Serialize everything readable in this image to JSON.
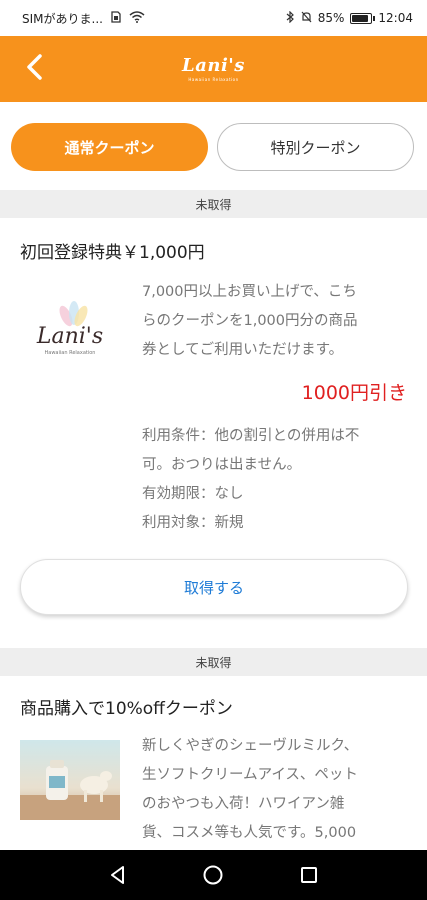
{
  "status_bar": {
    "carrier": "SIMがありま...",
    "battery_percent": "85%",
    "time": "12:04",
    "battery_level": 0.85
  },
  "header": {
    "logo_text": "Lani's",
    "logo_subtext": "Hawaiian Relaxation",
    "accent_color": "#f7921c"
  },
  "tabs": [
    {
      "label": "通常クーポン",
      "active": true
    },
    {
      "label": "特別クーポン",
      "active": false
    }
  ],
  "coupons": [
    {
      "status": "未取得",
      "title": "初回登録特典￥1,000円",
      "logo_text": "Lani's",
      "logo_subtext": "Hawaiian Relaxation",
      "description": [
        "7,000円以上お買い上げで、こち",
        "らのクーポンを1,000円分の商品",
        "券としてご利用いただけます。"
      ],
      "discount": "1000円引き",
      "conditions": [
        "利用条件：他の割引との併用は不",
        "可。おつりは出ません。"
      ],
      "expiry": "有効期限：なし",
      "target": "利用対象：新規",
      "button_label": "取得する"
    },
    {
      "status": "未取得",
      "title": "商品購入で10%offクーポン",
      "description": [
        "新しくやぎのシェーヴルミルク、",
        "生ソフトクリームアイス、ペット",
        "のおやつも入荷！ハワイアン雑",
        "貨、コスメ等も人気です。5,000"
      ]
    }
  ],
  "colors": {
    "discount": "#e02020",
    "link": "#1e7bd6"
  },
  "icons": {
    "back": "chevron-left-icon",
    "nav_back": "triangle-back-icon",
    "nav_home": "circle-home-icon",
    "nav_recents": "square-recents-icon"
  }
}
